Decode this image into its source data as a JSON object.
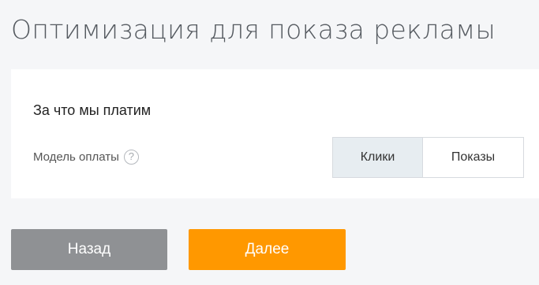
{
  "page": {
    "title": "Оптимизация для показа рекламы"
  },
  "payment": {
    "section_title": "За что мы платим",
    "model_label": "Модель оплаты",
    "help_glyph": "?",
    "options": [
      {
        "label": "Клики",
        "selected": true
      },
      {
        "label": "Показы",
        "selected": false
      }
    ]
  },
  "footer": {
    "back_label": "Назад",
    "next_label": "Далее"
  },
  "colors": {
    "accent": "#ff9800",
    "secondary_button": "#8f9194",
    "selected_option_bg": "#e7edf1",
    "page_bg": "#f5f6f8"
  }
}
